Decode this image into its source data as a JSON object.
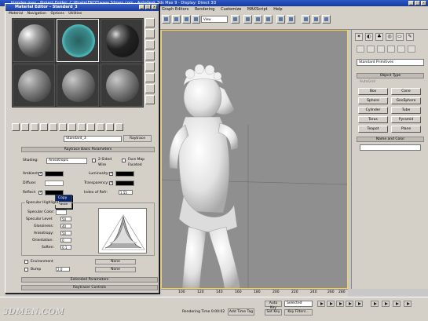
{
  "app": {
    "title": "bigodes.max - Project Folder: C:\\Pirate\\ERDT\\www.3dmen.com - Autodesk 3ds Max 9 - Display: Direct 3D",
    "menus": [
      "Graph Editors",
      "Rendering",
      "Customize",
      "MAXScript",
      "Help"
    ],
    "view_dropdown": "View"
  },
  "viewport": {
    "label": ""
  },
  "material_editor": {
    "title": "Material Editor - Standard_3",
    "menus": [
      "Material",
      "Navigation",
      "Options",
      "Utilities"
    ],
    "material_name": "Standard_3",
    "material_type": "Raytrace",
    "params_header": "Raytrace Basic Parameters",
    "shading_label": "Shading:",
    "shading_value": "Anisotropic",
    "two_sided": "2-Sided",
    "face_map": "Face Map",
    "wire": "Wire",
    "faceted": "Faceted",
    "ambient": "Ambient:",
    "diffuse": "Diffuse:",
    "reflect": "Reflect:",
    "luminosity": "Luminosity:",
    "transparency": "Transparency:",
    "index_of_refr": "Index of Refr:",
    "index_value": "1.55",
    "specular_highlight": "Specular Highlight",
    "specular_color": "Specular Color:",
    "specular_level": "Specular Level:",
    "glossiness": "Glossiness:",
    "anisotropy": "Anisotropy:",
    "orientation": "Orientation:",
    "soften": "Soften:",
    "specular_level_val": "50",
    "glossiness_val": "40",
    "anisotropy_val": "50",
    "orientation_val": "0",
    "soften_val": "0.1",
    "environment": "Environment",
    "bump": "Bump",
    "bump_val": "2.0",
    "none": "None",
    "context_menu": [
      "Copy",
      "Paste"
    ],
    "extended_params": "Extended Parameters",
    "raytracer_controls": "Raytracer Controls"
  },
  "command_panel": {
    "category": "Standard Primitives",
    "object_type": "Object Type",
    "autogrid": "AutoGrid",
    "objects": [
      "Box",
      "Cone",
      "Sphere",
      "GeoSphere",
      "Cylinder",
      "Tube",
      "Torus",
      "Pyramid",
      "Teapot",
      "Plane"
    ],
    "name_and_color": "Name and Color"
  },
  "timeline": {
    "ticks": [
      "100",
      "120",
      "140",
      "160",
      "180",
      "200",
      "220",
      "240",
      "260",
      "280"
    ]
  },
  "status": {
    "rendering_time": "Rendering Time 0:00:02",
    "add_time_tag": "Add Time Tag",
    "auto_key": "Auto Key",
    "set_key": "Set Key",
    "selected": "Selected",
    "key_filters": "Key Filters..."
  },
  "watermark": "3DMEN.COM"
}
